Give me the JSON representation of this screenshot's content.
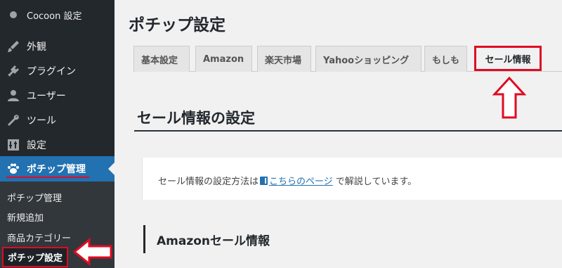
{
  "sidebar": {
    "cocoon": "Cocoon 設定",
    "items": [
      {
        "label": "外観",
        "icon": "brush-icon"
      },
      {
        "label": "プラグイン",
        "icon": "plug-icon"
      },
      {
        "label": "ユーザー",
        "icon": "user-icon"
      },
      {
        "label": "ツール",
        "icon": "wrench-icon"
      },
      {
        "label": "設定",
        "icon": "settings-icon"
      }
    ],
    "current": {
      "label": "ポチップ管理",
      "icon": "paw-icon"
    },
    "submenu": [
      "ポチップ管理",
      "新規追加",
      "商品カテゴリー",
      "ポチップ設定"
    ]
  },
  "page": {
    "title": "ポチップ設定",
    "tabs": [
      "基本設定",
      "Amazon",
      "楽天市場",
      "Yahooショッピング",
      "もしも",
      "セール情報"
    ],
    "active_tab": "セール情報",
    "section_title": "セール情報の設定",
    "info": {
      "before": "セール情報の設定方法は",
      "link": "こちらのページ",
      "after": "で解説しています。"
    },
    "subsection_title": "Amazonセール情報"
  },
  "colors": {
    "sidebar_bg": "#23282d",
    "current_bg": "#2271b1",
    "highlight_red": "#e00b22",
    "link": "#2271b1"
  }
}
